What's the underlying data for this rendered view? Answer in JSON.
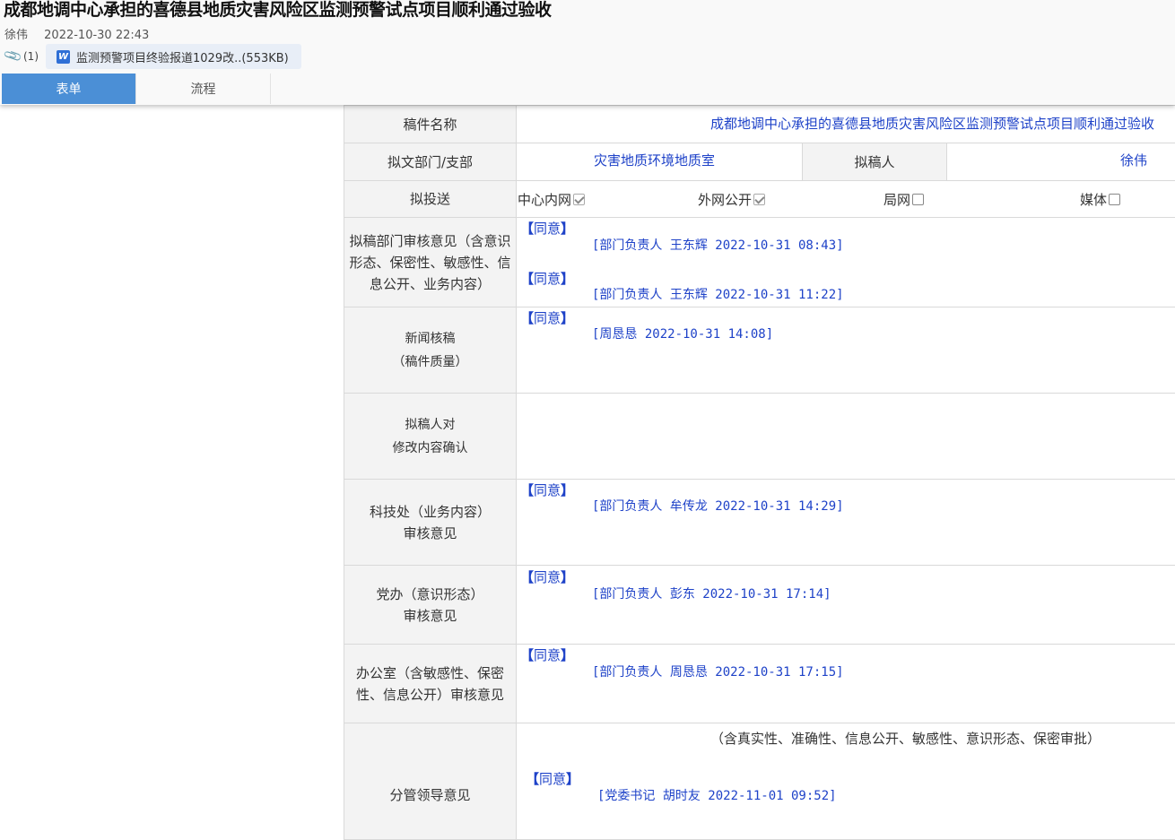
{
  "header": {
    "title": "成都地调中心承担的喜德县地质灾害风险区监测预警试点项目顺利通过验收",
    "author": "徐伟",
    "datetime": "2022-10-30 22:43",
    "attachment_count": "(1)",
    "attachment_icon": "word-icon",
    "attachment_name": "监测预警项目终验报道1029改..(553KB)"
  },
  "tabs": [
    {
      "label": "表单",
      "active": true
    },
    {
      "label": "流程",
      "active": false
    }
  ],
  "colors": {
    "accent": "#4b8fd6",
    "link": "#1e42c8"
  },
  "form": {
    "title_label": "稿件名称",
    "title_value": "成都地调中心承担的喜德县地质灾害风险区监测预警试点项目顺利通过验收",
    "dept_label": "拟文部门/支部",
    "dept_value": "灾害地质环境地质室",
    "drafter_label": "拟稿人",
    "drafter_value": "徐伟",
    "send_label": "拟投送",
    "send_options": [
      {
        "label": "中心内网",
        "checked": true
      },
      {
        "label": "外网公开",
        "checked": true
      },
      {
        "label": "局网",
        "checked": false
      },
      {
        "label": "媒体",
        "checked": false
      }
    ],
    "dept_review": {
      "label": "拟稿部门审核意见（含意识形态、保密性、敏感性、信息公开、业务内容）",
      "entries": [
        {
          "opinion": "同意",
          "sign": "[部门负责人 王东辉 2022-10-31 08:43]"
        },
        {
          "opinion": "同意",
          "sign": "[部门负责人 王东辉 2022-10-31 11:22]"
        }
      ]
    },
    "news_review": {
      "label_line1": "新闻核稿",
      "label_line2": "（稿件质量）",
      "entries": [
        {
          "opinion": "同意",
          "sign": "[周恳恳 2022-10-31 14:08]"
        }
      ]
    },
    "drafter_confirm": {
      "label_line1": "拟稿人对",
      "label_line2": "修改内容确认"
    },
    "tech_review": {
      "label_line1": "科技处（业务内容）",
      "label_line2": "审核意见",
      "entries": [
        {
          "opinion": "同意",
          "sign": "[部门负责人 牟传龙 2022-10-31 14:29]"
        }
      ]
    },
    "party_review": {
      "label_line1": "党办（意识形态）",
      "label_line2": "审核意见",
      "entries": [
        {
          "opinion": "同意",
          "sign": "[部门负责人 彭东 2022-10-31 17:14]"
        }
      ]
    },
    "office_review": {
      "label": "办公室（含敏感性、保密性、信息公开）审核意见",
      "entries": [
        {
          "opinion": "同意",
          "sign": "[部门负责人 周恳恳 2022-10-31 17:15]"
        }
      ]
    },
    "leader_review": {
      "label": "分管领导意见",
      "note": "（含真实性、准确性、信息公开、敏感性、意识形态、保密审批）",
      "entries": [
        {
          "opinion": "同意",
          "sign": "[党委书记 胡时友 2022-11-01 09:52]"
        }
      ]
    }
  }
}
